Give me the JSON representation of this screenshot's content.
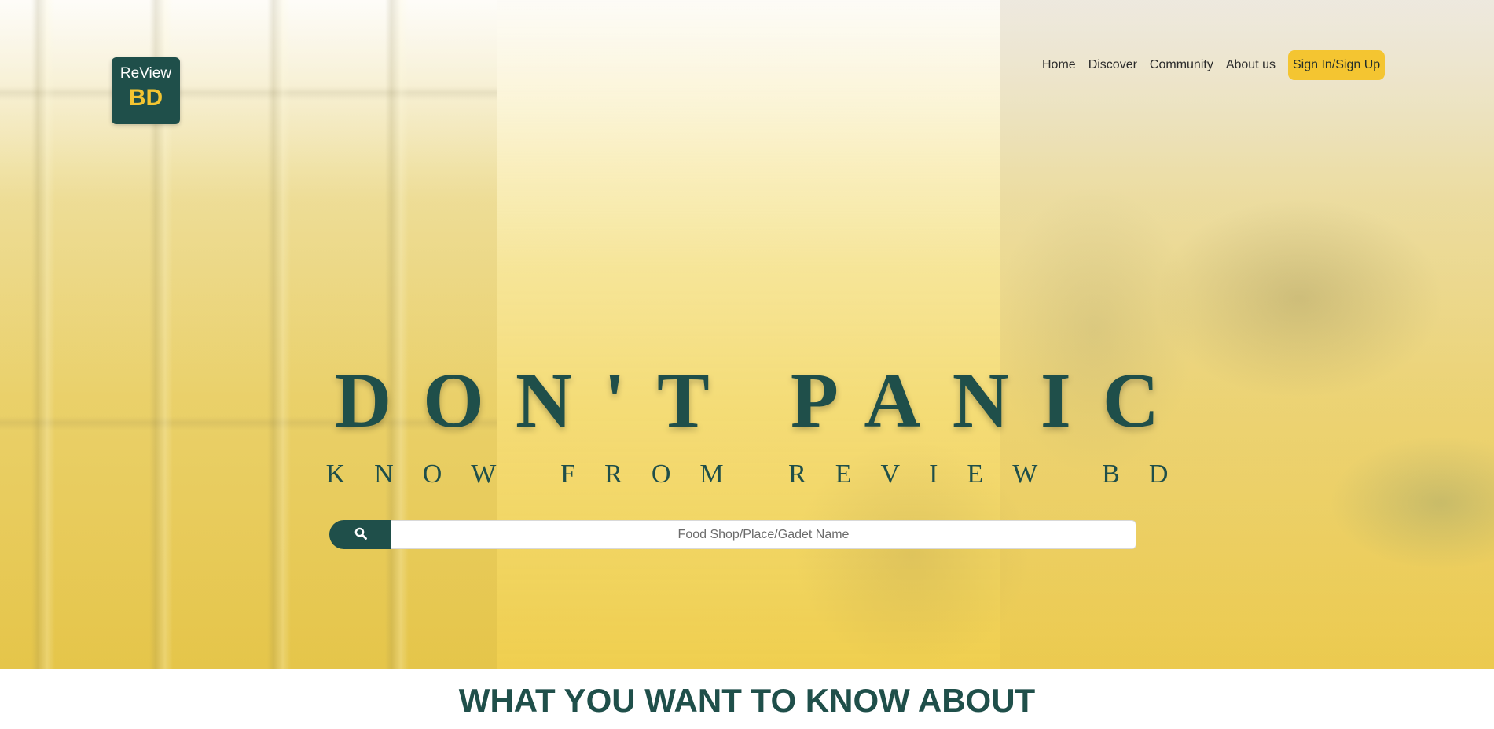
{
  "brand": {
    "top": "ReView",
    "bottom": "BD"
  },
  "nav": {
    "items": [
      {
        "label": "Home"
      },
      {
        "label": "Discover"
      },
      {
        "label": "Community"
      },
      {
        "label": "About us"
      }
    ],
    "cta_label": "Sign In/Sign Up"
  },
  "hero": {
    "headline": "DON'T PANIC",
    "subheadline": "KNOW FROM REVIEW BD"
  },
  "search": {
    "icon": "search-icon",
    "placeholder": "Food Shop/Place/Gadet Name",
    "value": ""
  },
  "section": {
    "title": "WHAT YOU WANT TO KNOW ABOUT"
  },
  "colors": {
    "primary": "#1f4f4a",
    "accent": "#f4c531",
    "hero_gradient": "#f3d96d"
  }
}
